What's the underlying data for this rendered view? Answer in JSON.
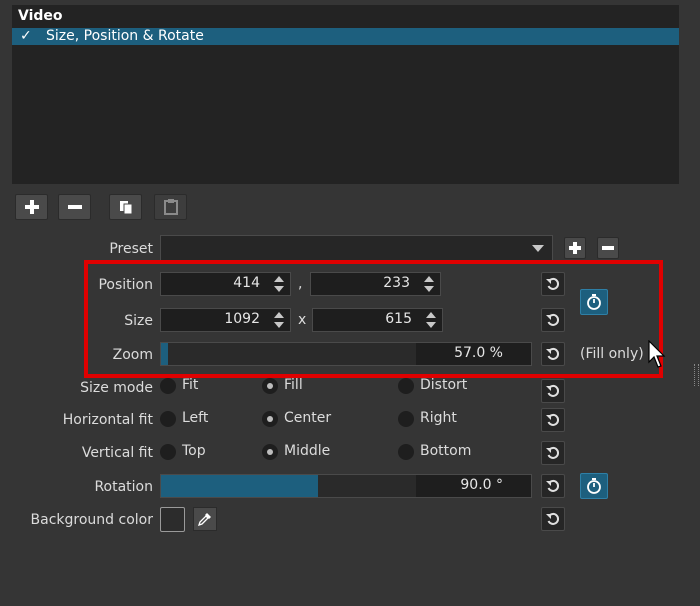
{
  "video": {
    "header": "Video",
    "filter": {
      "check": "✓",
      "label": "Size, Position & Rotate"
    }
  },
  "toolbar": {
    "add_icon": "plus-icon",
    "remove_icon": "minus-icon",
    "copy_icon": "copy-icon",
    "paste_icon": "paste-icon"
  },
  "preset": {
    "label": "Preset",
    "value": ""
  },
  "position": {
    "label": "Position",
    "x": "414",
    "separator": ",",
    "y": "233"
  },
  "size": {
    "label": "Size",
    "width": "1092",
    "separator": "x",
    "height": "615"
  },
  "zoom": {
    "label": "Zoom",
    "value_text": "57.0 %",
    "level_fraction": 0.02,
    "note": "(Fill only)"
  },
  "size_mode": {
    "label": "Size mode",
    "options": [
      "Fit",
      "Fill",
      "Distort"
    ],
    "selected": "Fill"
  },
  "horizontal_fit": {
    "label": "Horizontal fit",
    "options": [
      "Left",
      "Center",
      "Right"
    ],
    "selected": "Center"
  },
  "vertical_fit": {
    "label": "Vertical fit",
    "options": [
      "Top",
      "Middle",
      "Bottom"
    ],
    "selected": "Middle"
  },
  "rotation": {
    "label": "Rotation",
    "value_text": "90.0 °",
    "level_fraction": 0.425
  },
  "background_color": {
    "label": "Background color",
    "color": "#2c2c2c"
  },
  "colors": {
    "accent": "#1d5f7e",
    "highlight": "#e00000"
  }
}
